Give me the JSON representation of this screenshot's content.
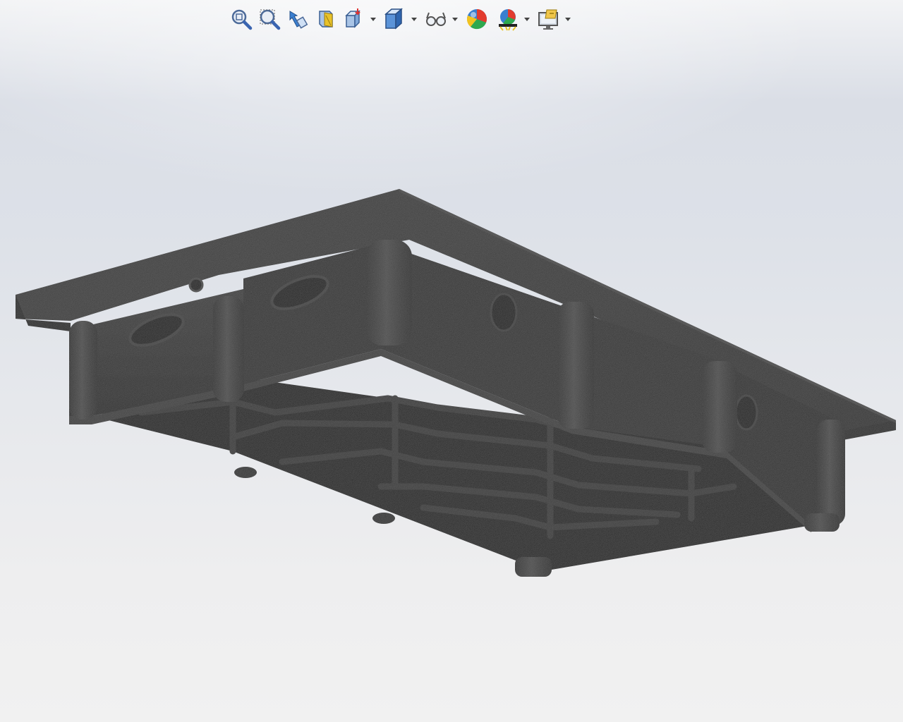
{
  "window": {
    "type": "cad-3d-viewport"
  },
  "toolbar": {
    "buttons": [
      {
        "id": "zoom-to-fit",
        "icon": "zoom-to-fit-icon"
      },
      {
        "id": "zoom-to-area",
        "icon": "zoom-to-area-icon"
      },
      {
        "id": "previous-view",
        "icon": "previous-view-icon"
      },
      {
        "id": "section-view",
        "icon": "section-view-icon"
      },
      {
        "id": "view-orientation",
        "icon": "view-orientation-icon",
        "has_dropdown": true
      },
      {
        "id": "display-style",
        "icon": "display-style-icon",
        "has_dropdown": true
      },
      {
        "id": "hide-show-items",
        "icon": "hide-show-items-icon",
        "has_dropdown": true
      },
      {
        "id": "edit-appearance",
        "icon": "edit-appearance-icon"
      },
      {
        "id": "apply-scene",
        "icon": "apply-scene-icon",
        "has_dropdown": true
      },
      {
        "id": "view-settings",
        "icon": "view-settings-icon",
        "has_dropdown": true
      }
    ]
  },
  "colors": {
    "background_top": "#dadee6",
    "background_bottom": "#f1f1f1",
    "model_face": "#2a2a2a",
    "model_dark": "#151515",
    "toolbar_accent_blue": "#3a7fd0",
    "toolbar_accent_yellow": "#e8c22a"
  }
}
